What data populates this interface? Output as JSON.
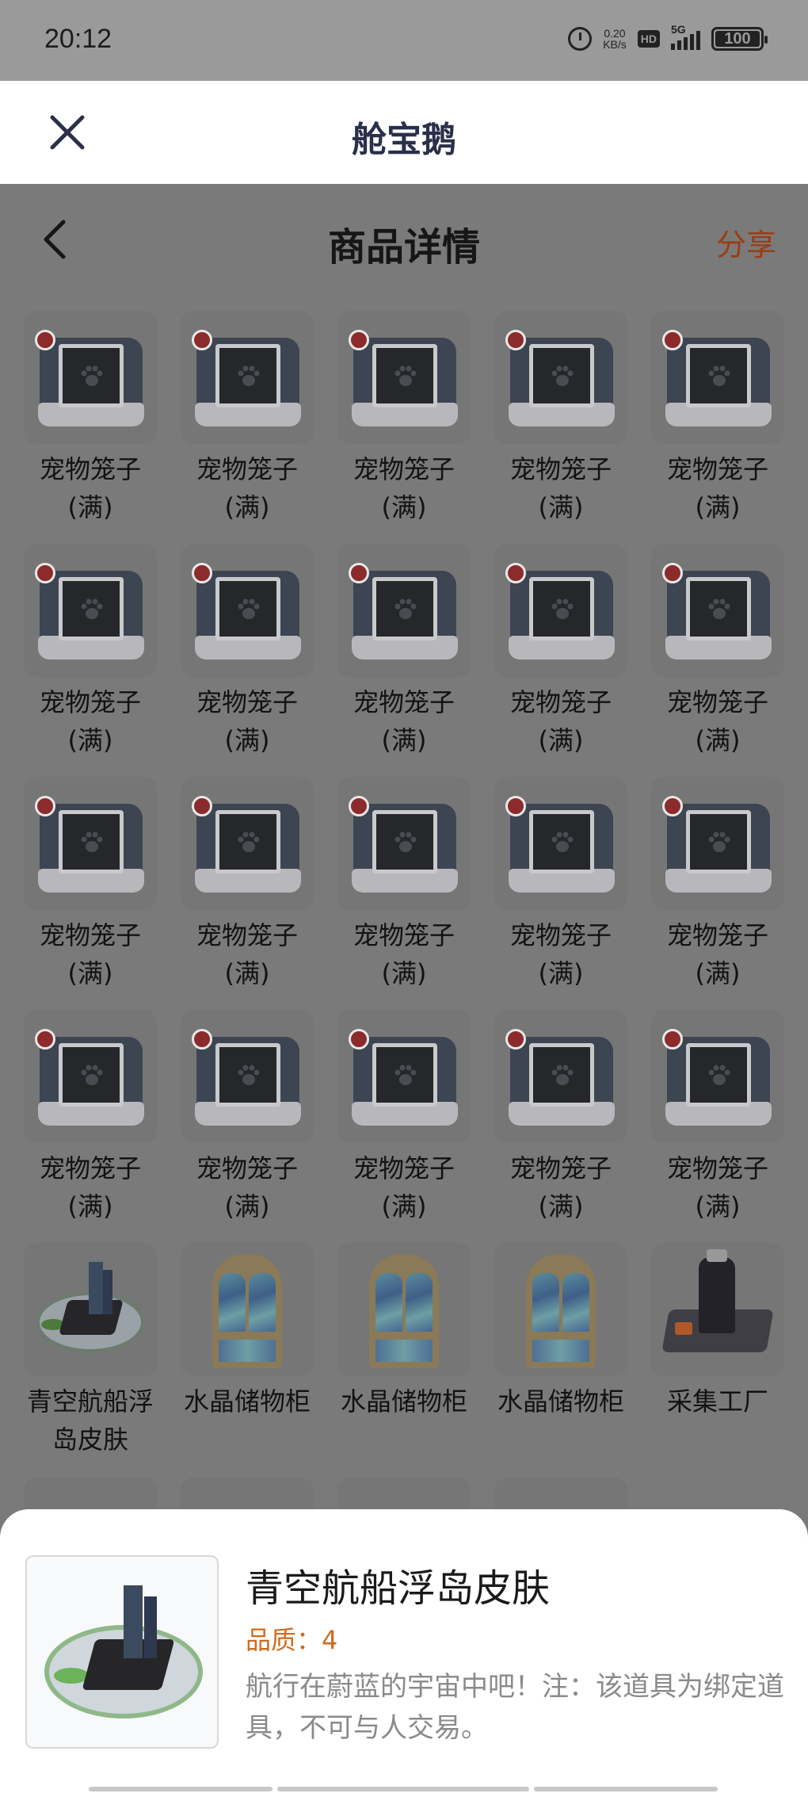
{
  "status_bar": {
    "time": "20:12",
    "net_speed_value": "0.20",
    "net_speed_unit": "KB/s",
    "hd_label": "HD",
    "network_label": "5G",
    "battery_level": "100"
  },
  "app_header": {
    "title": "舱宝鹅"
  },
  "nav": {
    "title": "商品详情",
    "share_label": "分享"
  },
  "items": [
    {
      "name_line1": "宠物笼子",
      "name_line2": "(满)",
      "art": "pet-cage"
    },
    {
      "name_line1": "宠物笼子",
      "name_line2": "(满)",
      "art": "pet-cage"
    },
    {
      "name_line1": "宠物笼子",
      "name_line2": "(满)",
      "art": "pet-cage"
    },
    {
      "name_line1": "宠物笼子",
      "name_line2": "(满)",
      "art": "pet-cage"
    },
    {
      "name_line1": "宠物笼子",
      "name_line2": "(满)",
      "art": "pet-cage"
    },
    {
      "name_line1": "宠物笼子",
      "name_line2": "(满)",
      "art": "pet-cage"
    },
    {
      "name_line1": "宠物笼子",
      "name_line2": "(满)",
      "art": "pet-cage"
    },
    {
      "name_line1": "宠物笼子",
      "name_line2": "(满)",
      "art": "pet-cage"
    },
    {
      "name_line1": "宠物笼子",
      "name_line2": "(满)",
      "art": "pet-cage"
    },
    {
      "name_line1": "宠物笼子",
      "name_line2": "(满)",
      "art": "pet-cage"
    },
    {
      "name_line1": "宠物笼子",
      "name_line2": "(满)",
      "art": "pet-cage"
    },
    {
      "name_line1": "宠物笼子",
      "name_line2": "(满)",
      "art": "pet-cage"
    },
    {
      "name_line1": "宠物笼子",
      "name_line2": "(满)",
      "art": "pet-cage"
    },
    {
      "name_line1": "宠物笼子",
      "name_line2": "(满)",
      "art": "pet-cage"
    },
    {
      "name_line1": "宠物笼子",
      "name_line2": "(满)",
      "art": "pet-cage"
    },
    {
      "name_line1": "宠物笼子",
      "name_line2": "(满)",
      "art": "pet-cage"
    },
    {
      "name_line1": "宠物笼子",
      "name_line2": "(满)",
      "art": "pet-cage"
    },
    {
      "name_line1": "宠物笼子",
      "name_line2": "(满)",
      "art": "pet-cage"
    },
    {
      "name_line1": "宠物笼子",
      "name_line2": "(满)",
      "art": "pet-cage"
    },
    {
      "name_line1": "宠物笼子",
      "name_line2": "(满)",
      "art": "pet-cage"
    },
    {
      "name_line1": "青空航船浮",
      "name_line2": "岛皮肤",
      "art": "island-skin"
    },
    {
      "name_line1": "水晶储物柜",
      "name_line2": "",
      "art": "crystal-cabinet"
    },
    {
      "name_line1": "水晶储物柜",
      "name_line2": "",
      "art": "crystal-cabinet"
    },
    {
      "name_line1": "水晶储物柜",
      "name_line2": "",
      "art": "crystal-cabinet"
    },
    {
      "name_line1": "采集工厂",
      "name_line2": "",
      "art": "gathering-factory"
    }
  ],
  "detail_sheet": {
    "title": "青空航船浮岛皮肤",
    "quality": "品质：4",
    "description": "航行在蔚蓝的宇宙中吧！注：该道具为绑定道具，不可与人交易。"
  },
  "colors": {
    "overlay": "#7a7a7a",
    "accent_orange": "#d06a1e",
    "share_link": "#9b3d10",
    "title_navy": "#2a2f4a"
  }
}
